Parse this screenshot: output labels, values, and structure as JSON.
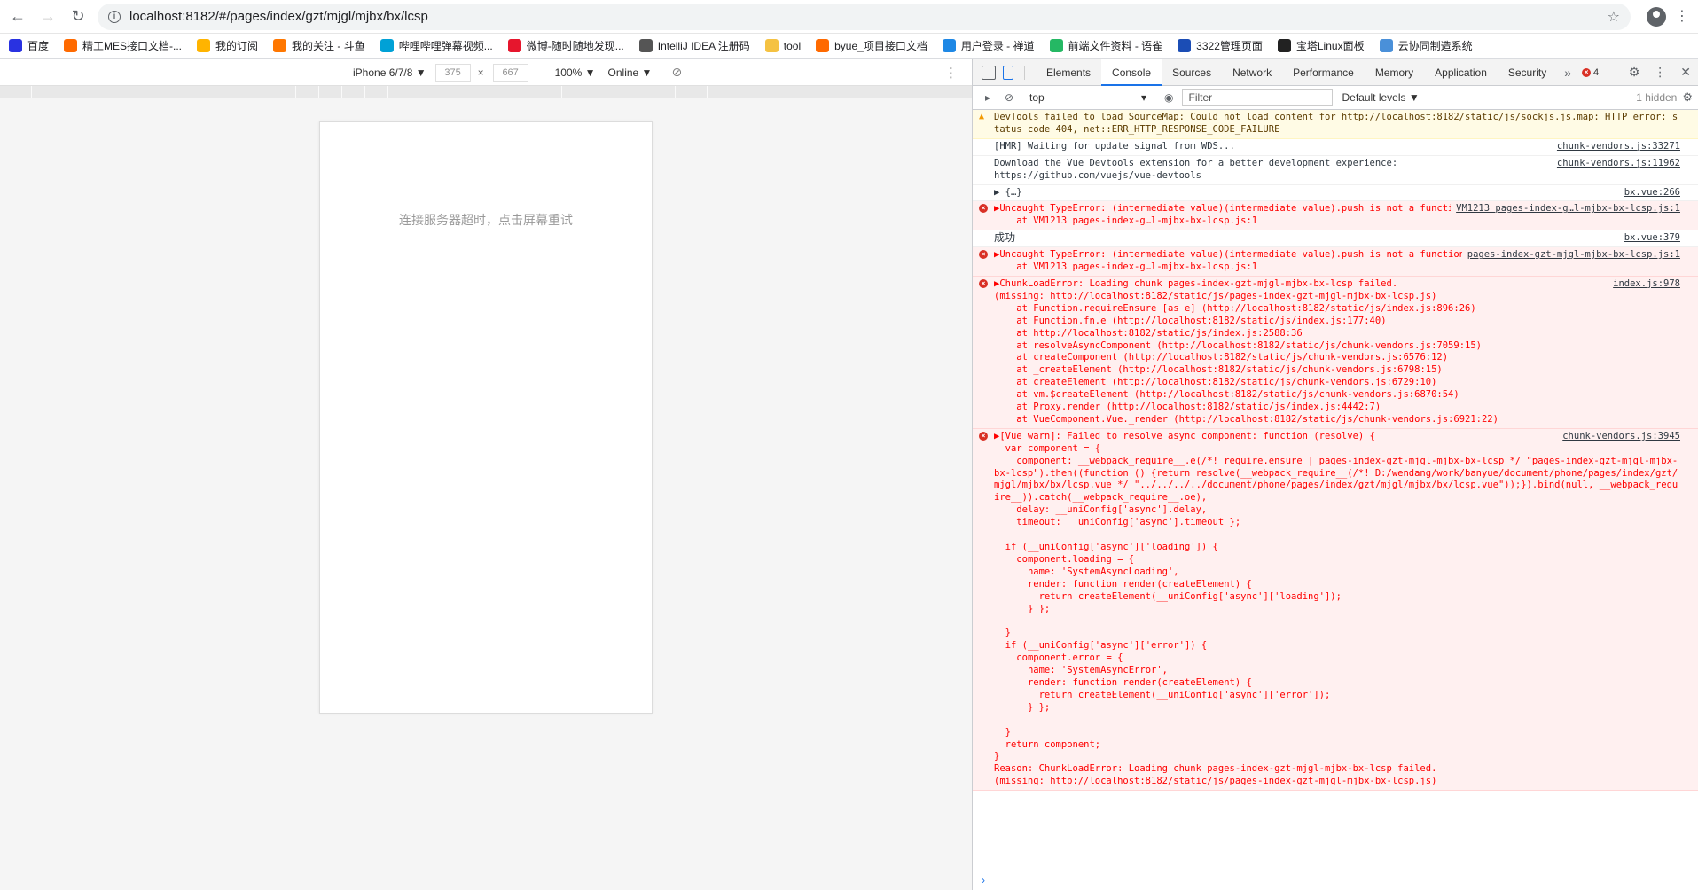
{
  "browser": {
    "url": "localhost:8182/#/pages/index/gzt/mjgl/mjbx/bx/lcsp",
    "bookmarks": [
      {
        "label": "百度",
        "color": "#2932e1"
      },
      {
        "label": "精工MES接口文档-...",
        "color": "#ff6a00"
      },
      {
        "label": "我的订阅",
        "color": "#ffb400"
      },
      {
        "label": "我的关注 - 斗鱼",
        "color": "#ff7700"
      },
      {
        "label": "哔哩哔哩弹幕视频...",
        "color": "#00a1d6"
      },
      {
        "label": "微博-随时随地发现...",
        "color": "#e6162d"
      },
      {
        "label": "IntelliJ IDEA 注册码",
        "color": "#555555"
      },
      {
        "label": "tool",
        "color": "#f5c242"
      },
      {
        "label": "byue_项目接口文档",
        "color": "#ff6a00"
      },
      {
        "label": "用户登录 - 禅道",
        "color": "#1e88e5"
      },
      {
        "label": "前端文件资料 - 语雀",
        "color": "#25b864"
      },
      {
        "label": "3322管理页面",
        "color": "#1b4db5"
      },
      {
        "label": "宝塔Linux面板",
        "color": "#222222"
      },
      {
        "label": "云协同制造系统",
        "color": "#4a90d9"
      }
    ]
  },
  "device_toolbar": {
    "device": "iPhone 6/7/8 ▼",
    "width": "375",
    "height": "667",
    "times": "×",
    "zoom": "100% ▼",
    "network": "Online ▼"
  },
  "phone": {
    "message": "连接服务器超时，点击屏幕重试"
  },
  "devtools": {
    "tabs": [
      "Elements",
      "Console",
      "Sources",
      "Network",
      "Performance",
      "Memory",
      "Application",
      "Security"
    ],
    "active_tab": "Console",
    "more_tabs": "»",
    "error_count": "4",
    "context": "top",
    "filter_placeholder": "Filter",
    "levels": "Default levels ▼",
    "hidden": "1 hidden"
  },
  "console": [
    {
      "type": "warn",
      "text": "DevTools failed to load SourceMap: Could not load content for http://localhost:8182/static/js/sockjs.js.map: HTTP error: status code 404, net::ERR_HTTP_RESPONSE_CODE_FAILURE",
      "source": ""
    },
    {
      "type": "plain",
      "text": "[HMR] Waiting for update signal from WDS...",
      "source": "chunk-vendors.js:33271"
    },
    {
      "type": "plain",
      "text": "Download the Vue Devtools extension for a better development experience:\nhttps://github.com/vuejs/vue-devtools",
      "source": "chunk-vendors.js:11962"
    },
    {
      "type": "plain",
      "text": "▶ {…}",
      "source": "bx.vue:266"
    },
    {
      "type": "error",
      "text": "▶Uncaught TypeError: (intermediate value)(intermediate value).push is not a function\n    at VM1213 pages-index-g…l-mjbx-bx-lcsp.js:1",
      "source": "VM1213 pages-index-g…l-mjbx-bx-lcsp.js:1"
    },
    {
      "type": "plain-cn",
      "text": "成功",
      "source": "bx.vue:379"
    },
    {
      "type": "error",
      "text": "▶Uncaught TypeError: (intermediate value)(intermediate value).push is not a function\n    at VM1213 pages-index-g…l-mjbx-bx-lcsp.js:1",
      "source": "pages-index-gzt-mjgl-mjbx-bx-lcsp.js:1"
    },
    {
      "type": "error",
      "text": "▶ChunkLoadError: Loading chunk pages-index-gzt-mjgl-mjbx-bx-lcsp failed.\n(missing: http://localhost:8182/static/js/pages-index-gzt-mjgl-mjbx-bx-lcsp.js)\n    at Function.requireEnsure [as e] (http://localhost:8182/static/js/index.js:896:26)\n    at Function.fn.e (http://localhost:8182/static/js/index.js:177:40)\n    at http://localhost:8182/static/js/index.js:2588:36\n    at resolveAsyncComponent (http://localhost:8182/static/js/chunk-vendors.js:7059:15)\n    at createComponent (http://localhost:8182/static/js/chunk-vendors.js:6576:12)\n    at _createElement (http://localhost:8182/static/js/chunk-vendors.js:6798:15)\n    at createElement (http://localhost:8182/static/js/chunk-vendors.js:6729:10)\n    at vm.$createElement (http://localhost:8182/static/js/chunk-vendors.js:6870:54)\n    at Proxy.render (http://localhost:8182/static/js/index.js:4442:7)\n    at VueComponent.Vue._render (http://localhost:8182/static/js/chunk-vendors.js:6921:22)",
      "source": "index.js:978"
    },
    {
      "type": "error",
      "text": "▶[Vue warn]: Failed to resolve async component: function (resolve) {\n  var component = {\n    component: __webpack_require__.e(/*! require.ensure | pages-index-gzt-mjgl-mjbx-bx-lcsp */ \"pages-index-gzt-mjgl-mjbx-bx-lcsp\").then((function () {return resolve(__webpack_require__(/*! D:/wendang/work/banyue/document/phone/pages/index/gzt/mjgl/mjbx/bx/lcsp.vue */ \"../../../../document/phone/pages/index/gzt/mjgl/mjbx/bx/lcsp.vue\"));}).bind(null, __webpack_require__)).catch(__webpack_require__.oe),\n    delay: __uniConfig['async'].delay,\n    timeout: __uniConfig['async'].timeout };\n\n  if (__uniConfig['async']['loading']) {\n    component.loading = {\n      name: 'SystemAsyncLoading',\n      render: function render(createElement) {\n        return createElement(__uniConfig['async']['loading']);\n      } };\n\n  }\n  if (__uniConfig['async']['error']) {\n    component.error = {\n      name: 'SystemAsyncError',\n      render: function render(createElement) {\n        return createElement(__uniConfig['async']['error']);\n      } };\n\n  }\n  return component;\n}\nReason: ChunkLoadError: Loading chunk pages-index-gzt-mjgl-mjbx-bx-lcsp failed.\n(missing: http://localhost:8182/static/js/pages-index-gzt-mjgl-mjbx-bx-lcsp.js)",
      "source": "chunk-vendors.js:3945"
    }
  ]
}
